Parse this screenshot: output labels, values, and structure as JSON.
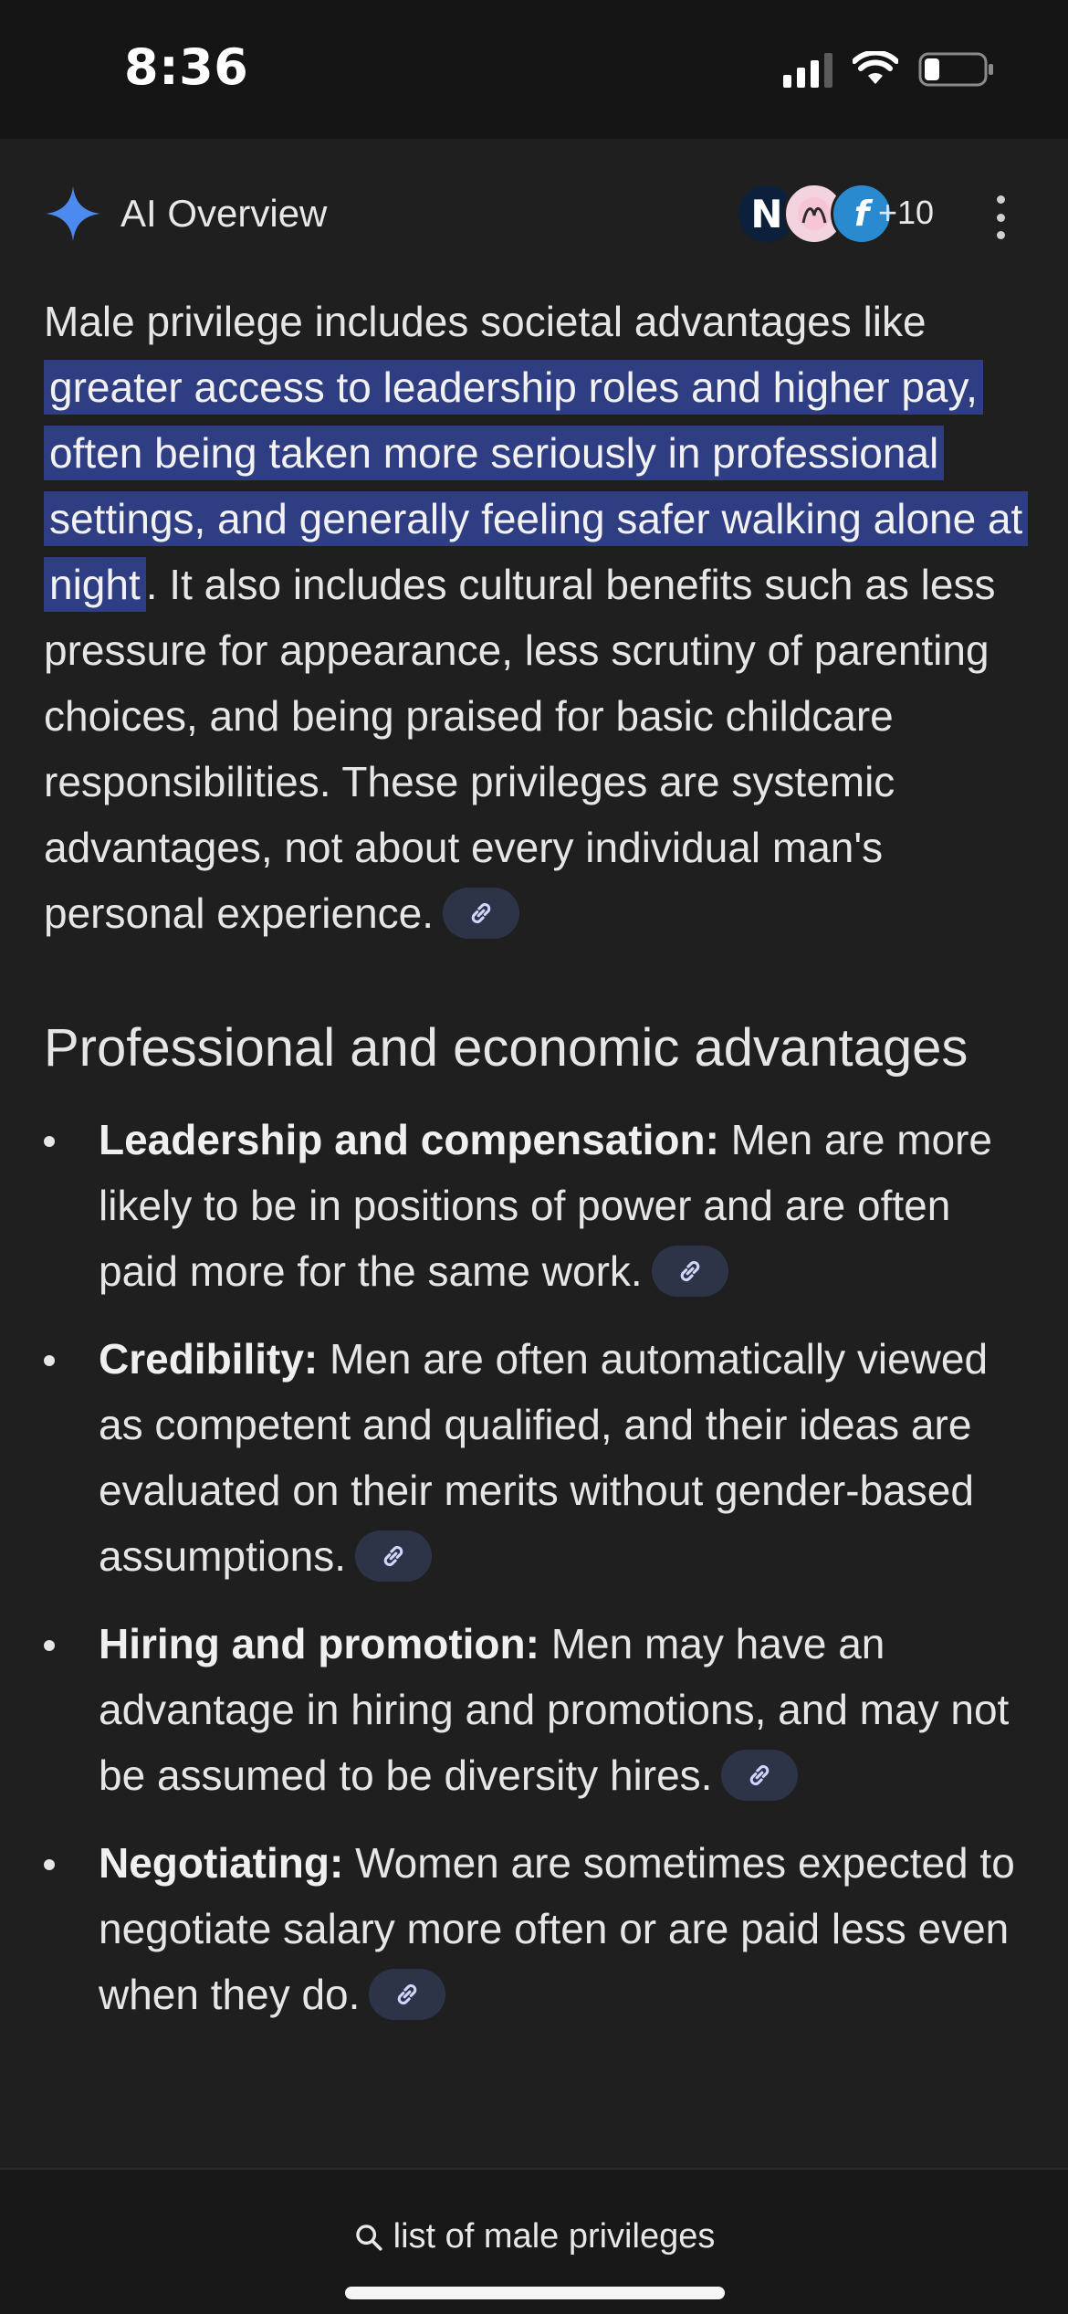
{
  "status_bar": {
    "time": "8:36",
    "battery_level": 0.25
  },
  "overview": {
    "title": "AI Overview",
    "sources_extra": "+10",
    "avatar_letters": [
      "N",
      "f"
    ],
    "summary": {
      "before": "Male privilege includes societal advantages like ",
      "highlight": "greater access to leadership roles and higher pay, often being taken more seriously in professional settings, and generally feeling safer walking alone at night",
      "after": ". It also includes cultural benefits such as less pressure for appearance, less scrutiny of parenting choices, and being praised for basic childcare responsibilities. These privileges are systemic advantages, not about every individual man's personal experience."
    },
    "section_title": "Professional and economic advantages",
    "items": [
      {
        "term": "Leadership and compensation:",
        "text": " Men are more likely to be in positions of power and are often paid more for the same work."
      },
      {
        "term": "Credibility:",
        "text": " Men are often automatically viewed as competent and qualified, and their ideas are evaluated on their merits without gender-based assumptions."
      },
      {
        "term": "Hiring and promotion:",
        "text": " Men may have an advantage in hiring and promotions, and may not be assumed to be diversity hires."
      },
      {
        "term": "Negotiating:",
        "text": " Women are sometimes expected to negotiate salary more often or are paid less even when they do."
      }
    ]
  },
  "bottom": {
    "query": "list of male privileges"
  },
  "colors": {
    "background": "#1f1f1f",
    "highlight": "#2f3e82",
    "chip": "#2e3447",
    "spark": "#4d8af0"
  }
}
